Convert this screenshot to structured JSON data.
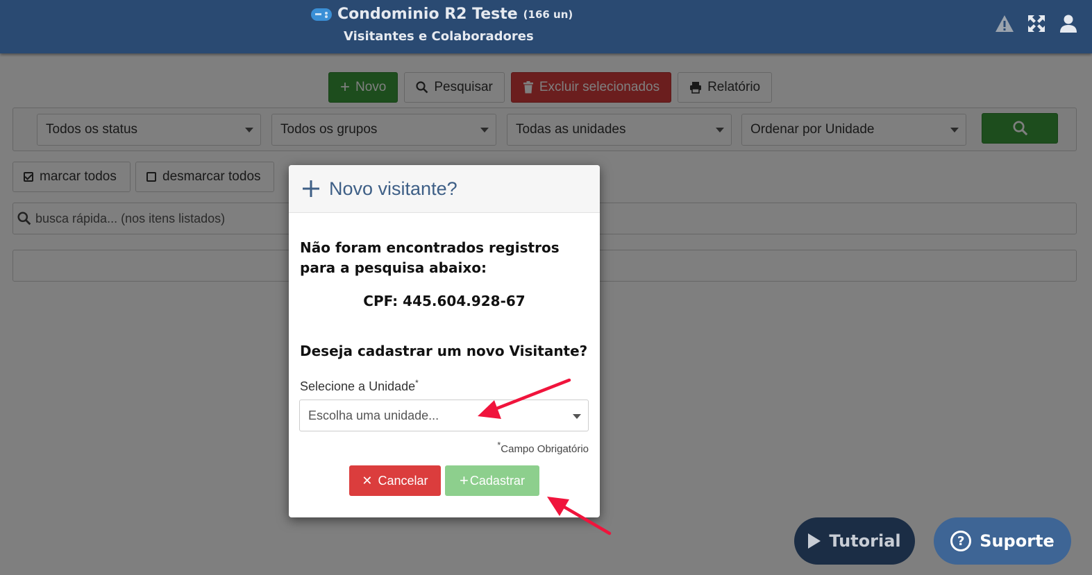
{
  "header": {
    "title": "Condominio R2 Teste",
    "units": "(166 un)",
    "subtitle": "Visitantes e Colaboradores",
    "icons": [
      "gamepad-icon",
      "warning-icon",
      "expand-icon",
      "user-icon"
    ]
  },
  "toolbar": {
    "novo": "Novo",
    "pesquisar": "Pesquisar",
    "excluir": "Excluir selecionados",
    "relatorio": "Relatório"
  },
  "filters": {
    "status": "Todos os status",
    "grupos": "Todos os grupos",
    "unidades": "Todas as unidades",
    "ordenar": "Ordenar por Unidade"
  },
  "selection": {
    "mark_all": "marcar todos",
    "unmark_all": "desmarcar todos"
  },
  "quick_search": {
    "placeholder": "busca rápida... (nos itens listados)"
  },
  "modal": {
    "title": "Novo visitante?",
    "message": "Não foram encontrados registros para a pesquisa abaixo:",
    "cpf": "CPF: 445.604.928-67",
    "question": "Deseja cadastrar um novo Visitante?",
    "unit_label": "Selecione a Unidade",
    "unit_placeholder": "Escolha uma unidade...",
    "required_note": "Campo Obrigatório",
    "cancel": "Cancelar",
    "submit": "Cadastrar"
  },
  "fab": {
    "tutorial": "Tutorial",
    "suporte": "Suporte"
  },
  "colors": {
    "header": "#2a4a72",
    "green": "#3a9a3a",
    "red": "#d63c3c",
    "annotation_arrow": "#f0143c"
  }
}
